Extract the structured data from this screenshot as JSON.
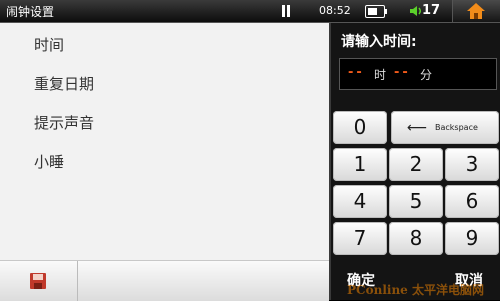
{
  "status_bar": {
    "title": "闹钟设置",
    "time": "08:52",
    "volume": "17"
  },
  "settings": {
    "items": [
      "时间",
      "重复日期",
      "提示声音",
      "小睡"
    ]
  },
  "time_entry": {
    "prompt": "请输入时间:",
    "hour_placeholder": "--",
    "hour_unit": "时",
    "minute_placeholder": "--",
    "minute_unit": "分"
  },
  "keypad": {
    "zero": "0",
    "backspace": "Backspace",
    "digits": [
      "1",
      "2",
      "3",
      "4",
      "5",
      "6",
      "7",
      "8",
      "9"
    ]
  },
  "actions": {
    "confirm": "确定",
    "cancel": "取消"
  },
  "watermark": "PConline 太平洋电脑网",
  "colors": {
    "accent_orange": "#f25a1a",
    "volume_green": "#5bd12a",
    "home_orange": "#f28c1a",
    "save_red": "#c0392b"
  }
}
